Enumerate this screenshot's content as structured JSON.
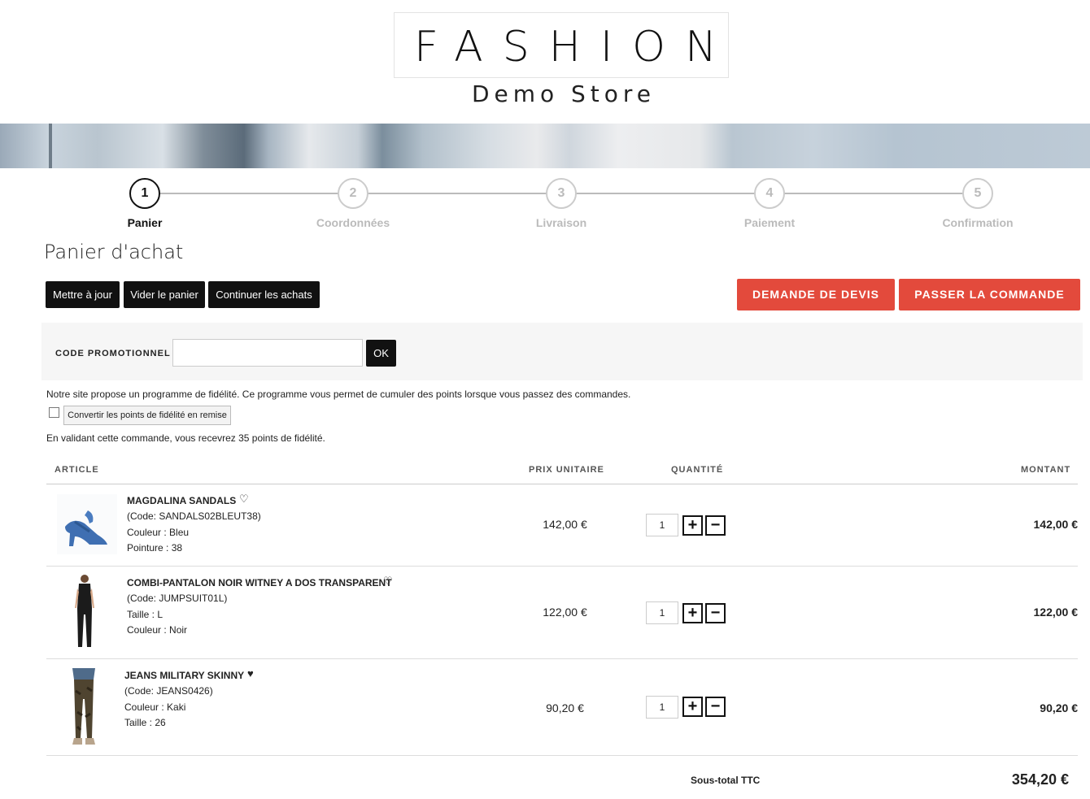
{
  "logo": {
    "title": "FASHION",
    "subtitle": "Demo Store"
  },
  "steps": [
    {
      "num": "1",
      "label": "Panier",
      "active": true
    },
    {
      "num": "2",
      "label": "Coordonnées",
      "active": false
    },
    {
      "num": "3",
      "label": "Livraison",
      "active": false
    },
    {
      "num": "4",
      "label": "Paiement",
      "active": false
    },
    {
      "num": "5",
      "label": "Confirmation",
      "active": false
    }
  ],
  "page_title": "Panier d'achat",
  "actions": {
    "update": "Mettre à jour",
    "empty": "Vider le panier",
    "continue": "Continuer les achats",
    "quote": "DEMANDE DE DEVIS",
    "order": "PASSER LA COMMANDE"
  },
  "promo": {
    "label": "CODE PROMOTIONNEL :",
    "value": "",
    "ok": "OK"
  },
  "loyalty": {
    "intro": "Notre site propose un programme de fidélité. Ce programme vous permet de cumuler des points lorsque vous passez des commandes.",
    "convert_button": "Convertir les points de fidélité en remise",
    "points_note": "En validant cette commande, vous recevrez 35 points de fidélité."
  },
  "table": {
    "headers": {
      "article": "ARTICLE",
      "unit_price": "PRIX UNITAIRE",
      "quantity": "QUANTITÉ",
      "amount": "MONTANT"
    },
    "items": [
      {
        "name": "MAGDALINA SANDALS",
        "code": "(Code: SANDALS02BLEUT38)",
        "attr1": "Couleur : Bleu",
        "attr2": "Pointure : 38",
        "price": "142,00 €",
        "qty": "1",
        "amount": "142,00 €",
        "favorite": false
      },
      {
        "name": "COMBI-PANTALON NOIR WITNEY A DOS TRANSPARENT",
        "code": "(Code: JUMPSUIT01L)",
        "attr1": "Taille : L",
        "attr2": "Couleur : Noir",
        "price": "122,00 €",
        "qty": "1",
        "amount": "122,00 €",
        "favorite": false
      },
      {
        "name": "JEANS MILITARY SKINNY",
        "code": "(Code: JEANS0426)",
        "attr1": "Couleur : Kaki",
        "attr2": "Taille : 26",
        "price": "90,20 €",
        "qty": "1",
        "amount": "90,20 €",
        "favorite": true
      }
    ]
  },
  "subtotal": {
    "label": "Sous-total TTC",
    "value": "354,20 €"
  },
  "icons": {
    "heart_empty": "heart-outline-icon",
    "heart_filled": "heart-filled-icon",
    "plus": "plus-icon",
    "minus": "minus-icon"
  },
  "colors": {
    "accent_red": "#e34a3c",
    "dark_button": "#111111"
  }
}
